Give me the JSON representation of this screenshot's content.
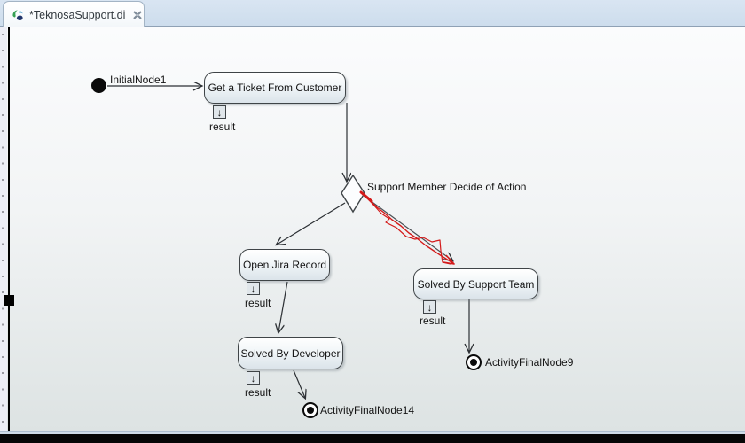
{
  "tab": {
    "title": "*TeknosaSupport.di"
  },
  "icons": {
    "pin_arrow": "↓",
    "papyrus": "papyrus-logo",
    "close": "x"
  },
  "colors": {
    "sketch_red": "#d41a1a",
    "edge": "#3a3f44",
    "tab_strip": "#d0dfee",
    "canvas_top": "#fbfcfd",
    "canvas_bottom": "#dde3e3"
  },
  "nodes": {
    "initial": {
      "label": "InitialNode1"
    },
    "get_ticket": {
      "label": "Get a Ticket From Customer",
      "pin": "result"
    },
    "decision": {
      "label": "Support Member Decide of Action"
    },
    "open_jira": {
      "label": "Open Jira Record",
      "pin": "result"
    },
    "solved_support": {
      "label": "Solved By Support Team",
      "pin": "result"
    },
    "solved_dev": {
      "label": "Solved By Developer",
      "pin": "result"
    },
    "final9": {
      "label": "ActivityFinalNode9"
    },
    "final14": {
      "label": "ActivityFinalNode14"
    }
  }
}
